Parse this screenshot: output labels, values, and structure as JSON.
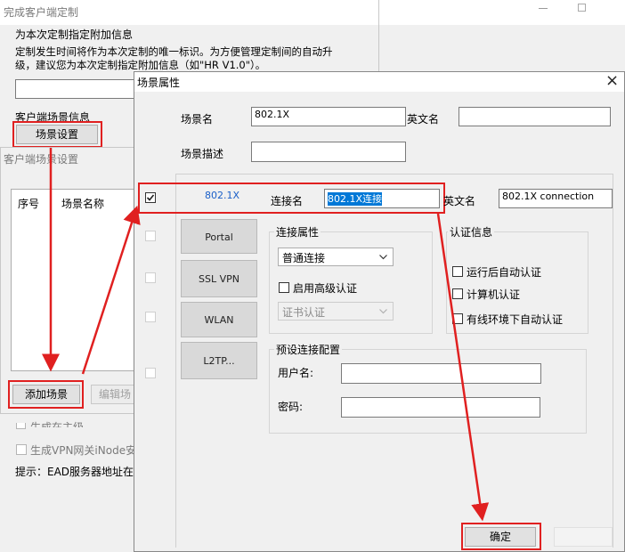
{
  "bg_window": {
    "title": "完成客户端定制",
    "section_title": "为本次定制指定附加信息",
    "desc_line1": "定制发生时间将作为本次定制的唯一标识。为方便管理定制间的自动升",
    "desc_line2": "级，建议您为本次定制指定附加信息（如\"HR V1.0\"）。",
    "addinfo_value": "",
    "scene_info_label": "客户端场景信息",
    "scene_setting_button": "场景设置",
    "gen_line1": "生成在主级…",
    "gen_vpn_label": "生成VPN网关iNode安装",
    "hint": "提示：EAD服务器地址在"
  },
  "scene_window": {
    "title": "客户端场景设置",
    "col_index": "序号",
    "col_name": "场景名称",
    "add_button": "添加场景",
    "edit_button": "编辑场"
  },
  "props_window": {
    "title": "场景属性",
    "close_glyph": "×",
    "scene_name_label": "场景名",
    "scene_name_value": "802.1X",
    "english_name_label": "英文名",
    "english_name_value": "",
    "scene_desc_label": "场景描述",
    "scene_desc_value": "",
    "tab_active": "802.1X",
    "tabs": [
      "Portal",
      "SSL VPN",
      "WLAN",
      "L2TP..."
    ],
    "conn_name_label": "连接名",
    "conn_name_value": "802.1X连接",
    "conn_en_label": "英文名",
    "conn_en_value": "802.1X connection",
    "conn_props_group": "连接属性",
    "conn_type_value": "普通连接",
    "advanced_auth_label": "启用高级认证",
    "cert_auth_value": "证书认证",
    "auth_group": "认证信息",
    "auth_options": [
      "运行后自动认证",
      "计算机认证",
      "有线环境下自动认证"
    ],
    "preset_group": "预设连接配置",
    "username_label": "用户名:",
    "username_value": "",
    "password_label": "密码:",
    "password_value": "",
    "ok_button": "确定",
    "dropdown_icon": "chevron-down-icon"
  },
  "colors": {
    "annotation": "#e02020",
    "selection": "#0078d7",
    "tab_active_text": "#1a5fc8"
  }
}
